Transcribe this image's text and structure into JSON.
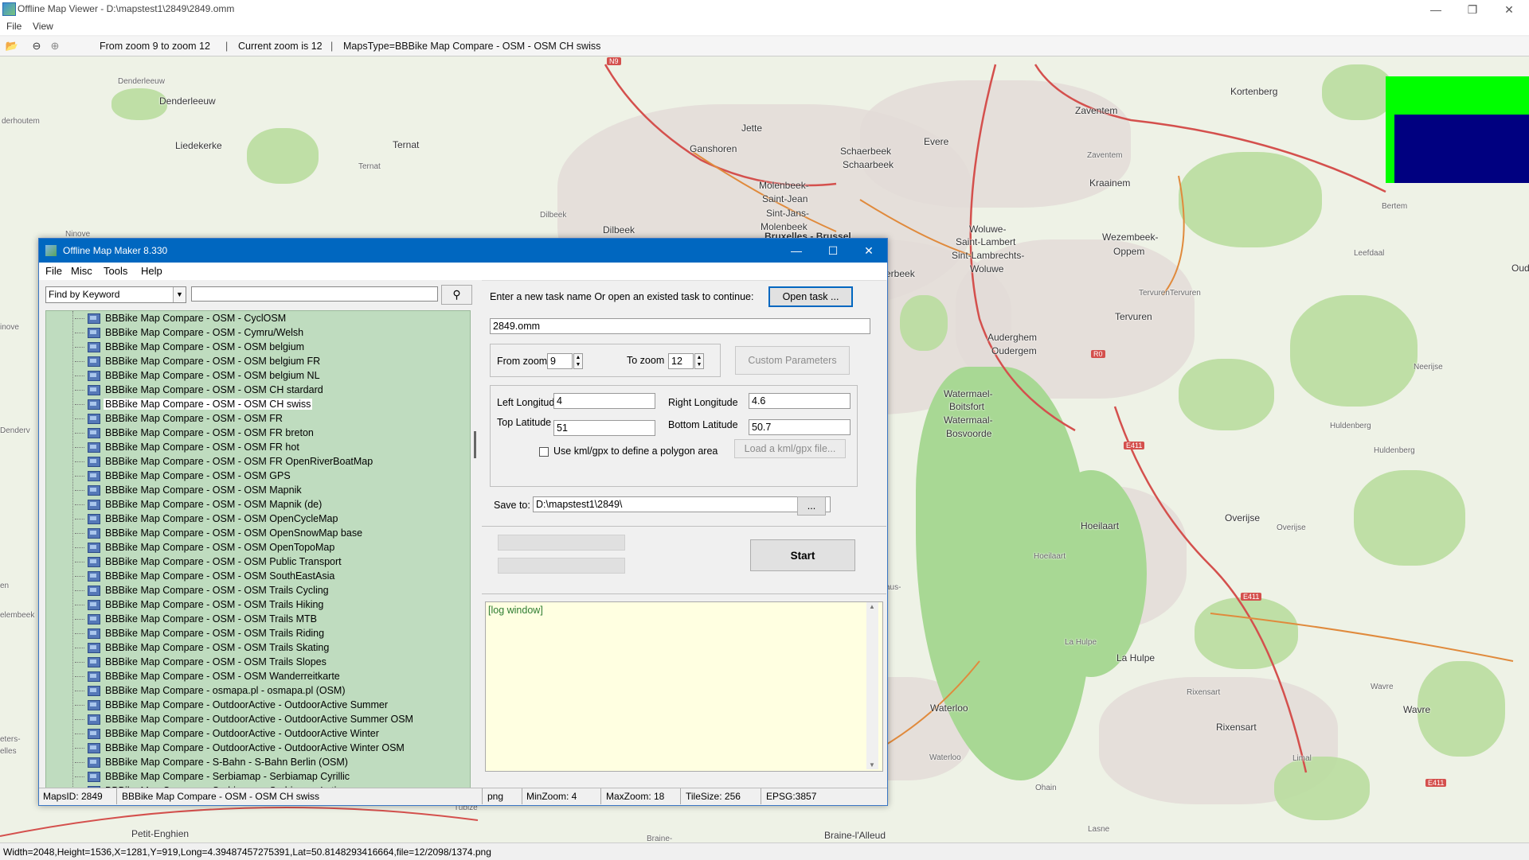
{
  "app": {
    "title": "Offline Map Viewer - D:\\mapstest1\\2849\\2849.omm",
    "menu": [
      "File",
      "View"
    ],
    "toolbar": {
      "zoom_range": "From zoom 9 to zoom 12",
      "current_zoom": "Current zoom is 12",
      "maps_type": "MapsType=BBBike Map Compare - OSM - OSM CH swiss"
    },
    "status": "Width=2048,Height=1536,X=1281,Y=919,Long=4.39487457275391,Lat=50.8148293416664,file=12/2098/1374.png"
  },
  "map": {
    "labels": [
      "Denderleeuw",
      "Denderleeuw",
      "derhoutem",
      "Liedekerke",
      "Ternat",
      "Ternat",
      "Jette",
      "Ganshoren",
      "Dilbeek",
      "Dilbeek",
      "Molenbeek-",
      "Saint-Jean",
      "Sint-Jans-",
      "Molenbeek",
      "Bruxelles - Brussel",
      "Schaerbeek",
      "Schaarbeek",
      "Evere",
      "Zaventem",
      "Zaventem",
      "Kortenberg",
      "Kraainem",
      "Woluwe-",
      "Saint-Lambert",
      "Sint-Lambrechts-",
      "Woluwe",
      "Wezembeek-",
      "Oppem",
      "Leefdaal",
      "Bertem",
      "Tervuren",
      "TervurenTervuren",
      "Auderghem",
      "Oudergem",
      "Watermael-",
      "Boitsfort",
      "Watermaal-",
      "Bosvoorde",
      "Huldenberg",
      "Huldenberg",
      "Neerijse",
      "Hoeilaart",
      "Hoeilaart",
      "Overijse",
      "Overijse",
      "La Hulpe",
      "La Hulpe",
      "Waterloo",
      "Waterloo",
      "Rixensart",
      "Rixensart",
      "Wavre",
      "Wavre",
      "Limal",
      "Ohain",
      "Lasne",
      "Braine-l'Alleud",
      "Petit-Enghien",
      "Tubize",
      "Braine-",
      "Ninove",
      "inove",
      "Denderv",
      "elembeek",
      "eters-",
      "elles",
      "en",
      "Oud",
      "erbeek",
      "aus-"
    ],
    "road_badges": [
      "N9",
      "R0",
      "E411",
      "E411",
      "E411"
    ],
    "overlay_colors": {
      "outer": "#00ff00",
      "inner": "#000080"
    }
  },
  "dialog": {
    "title": "Offline Map Maker 8.330",
    "menu": [
      "File",
      "Misc",
      "Tools",
      "Help"
    ],
    "find_mode": "Find by Keyword",
    "search_value": "",
    "maps": [
      "BBBike Map Compare - OSM - CyclOSM",
      "BBBike Map Compare - OSM - Cymru/Welsh",
      "BBBike Map Compare - OSM - OSM belgium",
      "BBBike Map Compare - OSM - OSM belgium FR",
      "BBBike Map Compare - OSM - OSM belgium NL",
      "BBBike Map Compare - OSM - OSM CH stardard",
      "BBBike Map Compare - OSM - OSM CH swiss",
      "BBBike Map Compare - OSM - OSM FR",
      "BBBike Map Compare - OSM - OSM FR breton",
      "BBBike Map Compare - OSM - OSM FR hot",
      "BBBike Map Compare - OSM - OSM FR OpenRiverBoatMap",
      "BBBike Map Compare - OSM - OSM GPS",
      "BBBike Map Compare - OSM - OSM Mapnik",
      "BBBike Map Compare - OSM - OSM Mapnik (de)",
      "BBBike Map Compare - OSM - OSM OpenCycleMap",
      "BBBike Map Compare - OSM - OSM OpenSnowMap base",
      "BBBike Map Compare - OSM - OSM OpenTopoMap",
      "BBBike Map Compare - OSM - OSM Public Transport",
      "BBBike Map Compare - OSM - OSM SouthEastAsia",
      "BBBike Map Compare - OSM - OSM Trails Cycling",
      "BBBike Map Compare - OSM - OSM Trails Hiking",
      "BBBike Map Compare - OSM - OSM Trails MTB",
      "BBBike Map Compare - OSM - OSM Trails Riding",
      "BBBike Map Compare - OSM - OSM Trails Skating",
      "BBBike Map Compare - OSM - OSM Trails Slopes",
      "BBBike Map Compare - OSM - OSM Wanderreitkarte",
      "BBBike Map Compare - osmapa.pl - osmapa.pl (OSM)",
      "BBBike Map Compare - OutdoorActive - OutdoorActive Summer",
      "BBBike Map Compare - OutdoorActive - OutdoorActive Summer OSM",
      "BBBike Map Compare - OutdoorActive - OutdoorActive Winter",
      "BBBike Map Compare - OutdoorActive - OutdoorActive Winter OSM",
      "BBBike Map Compare - S-Bahn - S-Bahn Berlin (OSM)",
      "BBBike Map Compare - Serbiamap - Serbiamap Cyrillic",
      "BBBike Map Compare - Serbiamap - Serbiamap Latin"
    ],
    "selected_map": "BBBike Map Compare - OSM - OSM CH swiss",
    "task_prompt": "Enter a new task name Or open an existed task to continue:",
    "open_task": "Open task ...",
    "task_name": "2849.omm",
    "from_zoom_label": "From zoom",
    "from_zoom": "9",
    "to_zoom_label": "To zoom",
    "to_zoom": "12",
    "custom_params": "Custom Parameters",
    "left_lon_label": "Left Longitude",
    "left_lon": "4",
    "right_lon_label": "Right Longitude",
    "right_lon": "4.6",
    "top_lat_label": "Top Latitude",
    "top_lat": "51",
    "bottom_lat_label": "Bottom Latitude",
    "bottom_lat": "50.7",
    "kml_label": "Use kml/gpx to define a polygon area",
    "load_kml": "Load a kml/gpx file...",
    "save_label": "Save to:",
    "save_path": "D:\\mapstest1\\2849\\",
    "browse": "...",
    "start": "Start",
    "log": "[log window]",
    "status": {
      "maps_id": "MapsID: 2849",
      "name": "BBBike Map Compare - OSM - OSM CH swiss",
      "format": "png",
      "min_zoom": "MinZoom: 4",
      "max_zoom": "MaxZoom: 18",
      "tile_size": "TileSize: 256",
      "epsg": "EPSG:3857"
    }
  }
}
